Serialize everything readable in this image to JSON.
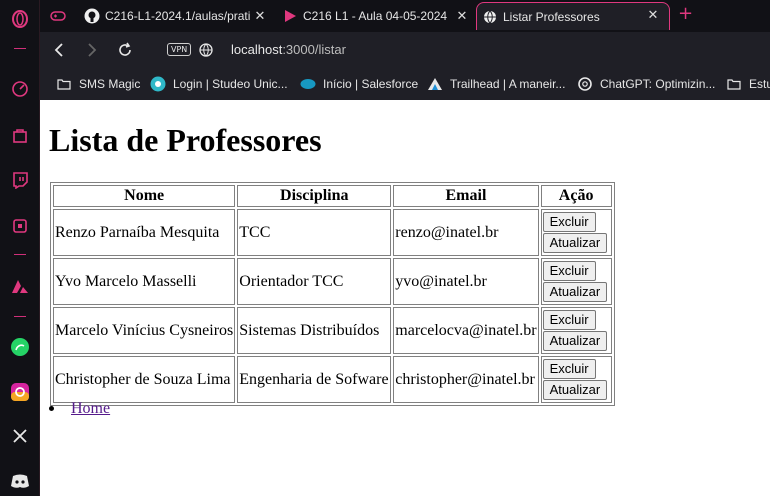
{
  "browser": {
    "tabs": [
      {
        "icon": "gamepad-icon",
        "title": "",
        "active": false
      },
      {
        "icon": "github-icon",
        "title": "C216-L1-2024.1/aulas/prati",
        "active": false
      },
      {
        "icon": "video-icon",
        "title": "C216 L1 - Aula 04-05-2024",
        "active": false
      },
      {
        "icon": "globe-icon",
        "title": "Listar Professores",
        "active": true
      }
    ],
    "address": {
      "vpn_label": "VPN",
      "host": "localhost",
      "path": ":3000/listar"
    },
    "bookmarks": [
      {
        "icon": "folder-icon",
        "label": "SMS Magic"
      },
      {
        "icon": "studeo-icon",
        "label": "Login | Studeo Unic..."
      },
      {
        "icon": "salesforce-icon",
        "label": "Início | Salesforce"
      },
      {
        "icon": "trailhead-icon",
        "label": "Trailhead | A maneir..."
      },
      {
        "icon": "chatgpt-icon",
        "label": "ChatGPT: Optimizin..."
      },
      {
        "icon": "folder-icon",
        "label": "Estu"
      }
    ],
    "sidebar_icons": [
      "opera-logo-icon",
      "speed-dial-icon",
      "shopping-bag-icon",
      "twitch-icon",
      "crypto-wallet-icon",
      "aria-icon",
      "whatsapp-icon",
      "instagram-icon",
      "x-twitter-icon",
      "discord-icon"
    ],
    "accent_color": "#e0387f"
  },
  "page": {
    "heading": "Lista de Professores",
    "table": {
      "headers": [
        "Nome",
        "Disciplina",
        "Email",
        "Ação"
      ],
      "rows": [
        {
          "nome": "Renzo Parnaíba Mesquita",
          "disciplina": "TCC",
          "email": "renzo@inatel.br"
        },
        {
          "nome": "Yvo Marcelo Masselli",
          "disciplina": "Orientador TCC",
          "email": "yvo@inatel.br"
        },
        {
          "nome": "Marcelo Vinícius Cysneiros",
          "disciplina": "Sistemas Distribuídos",
          "email": "marcelocva@inatel.br"
        },
        {
          "nome": "Christopher de Souza Lima",
          "disciplina": "Engenharia de Sofware",
          "email": "christopher@inatel.br"
        }
      ],
      "delete_label": "Excluir",
      "update_label": "Atualizar"
    },
    "links": [
      {
        "label": "Home"
      }
    ]
  }
}
